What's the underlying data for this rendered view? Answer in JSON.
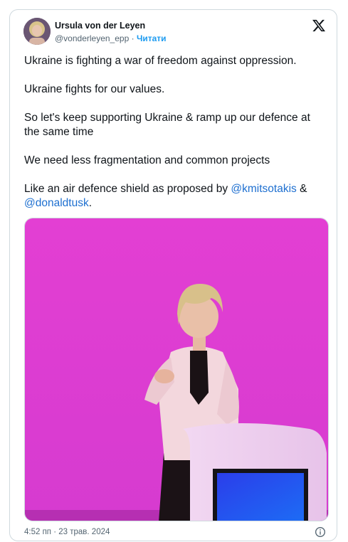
{
  "author": {
    "name": "Ursula von der Leyen",
    "handle": "@vonderleyen_epp",
    "separator": " · ",
    "follow_label": "Читати"
  },
  "tweet": {
    "p1": "Ukraine is fighting a war of freedom against oppression.",
    "p2": "Ukraine fights for our values.",
    "p3": "So let's keep supporting Ukraine & ramp up our defence at the same time",
    "p4": "We need less fragmentation and common projects",
    "p5_prefix": "Like an air defence shield as proposed by ",
    "mention1": "@kmitsotakis",
    "p5_mid": " & ",
    "mention2": "@donaldtusk",
    "p5_suffix": "."
  },
  "footer": {
    "timestamp": "4:52 пп · 23 трав. 2024"
  },
  "icons": {
    "platform_logo": "x-logo-icon",
    "info": "info-icon",
    "avatar": "avatar"
  },
  "colors": {
    "link": "#1d6fd0",
    "follow": "#1d9bf0",
    "muted": "#536471",
    "stage_background": "#e43fd6"
  }
}
